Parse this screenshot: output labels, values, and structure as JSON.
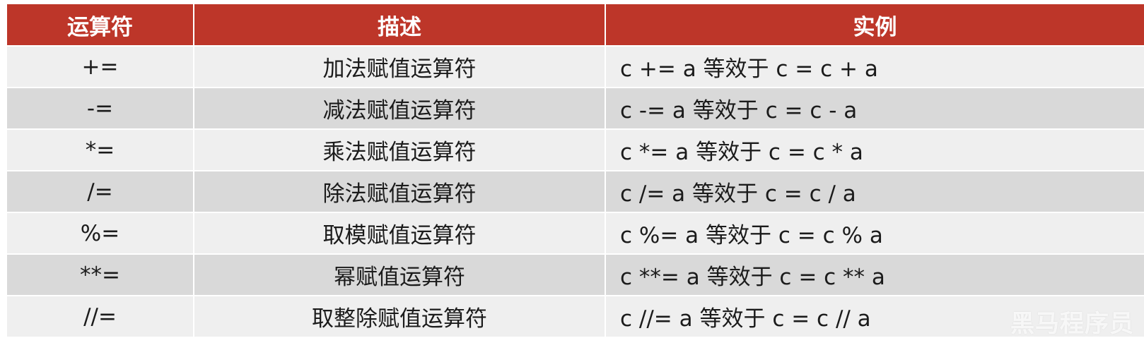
{
  "colors": {
    "header_bg": "#bd3629",
    "header_text": "#ffffff",
    "row_light": "#efefef",
    "row_dark": "#d9d9d9"
  },
  "table": {
    "headers": [
      "运算符",
      "描述",
      "实例"
    ],
    "rows": [
      {
        "op": "+=",
        "desc": "加法赋值运算符",
        "example": "c += a 等效于 c = c + a"
      },
      {
        "op": "-=",
        "desc": "减法赋值运算符",
        "example": "c -= a 等效于 c = c - a"
      },
      {
        "op": "*=",
        "desc": "乘法赋值运算符",
        "example": "c *= a 等效于 c = c * a"
      },
      {
        "op": "/=",
        "desc": "除法赋值运算符",
        "example": "c /= a 等效于 c = c / a"
      },
      {
        "op": "%=",
        "desc": "取模赋值运算符",
        "example": "c %= a 等效于 c = c % a"
      },
      {
        "op": "**=",
        "desc": "幂赋值运算符",
        "example": "c **= a 等效于 c = c ** a"
      },
      {
        "op": "//=",
        "desc": "取整除赋值运算符",
        "example": "c //= a 等效于 c = c // a"
      }
    ]
  },
  "watermark": "黑马程序员"
}
